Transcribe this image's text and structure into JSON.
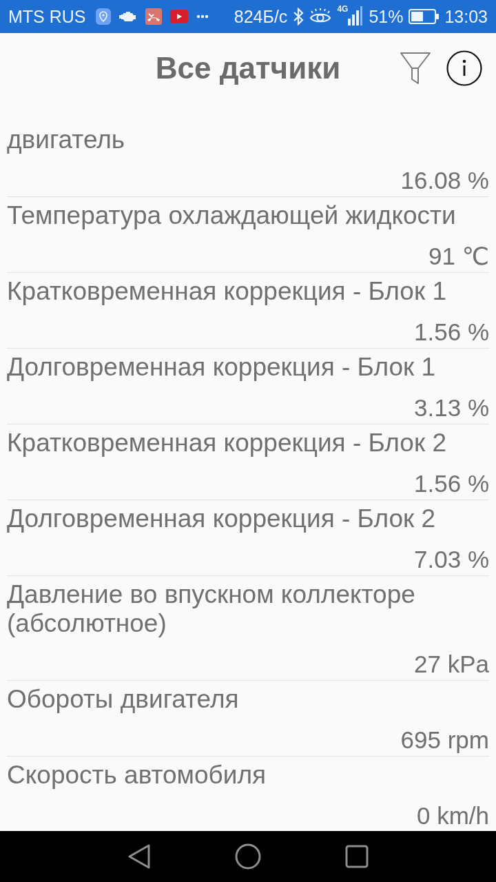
{
  "status_bar": {
    "carrier": "MTS RUS",
    "data_speed": "824Б/с",
    "network_type": "4G",
    "battery_percent": "51%",
    "time": "13:03"
  },
  "header": {
    "title": "Все датчики"
  },
  "sensors": [
    {
      "name": "двигатель",
      "value": "16.08 %"
    },
    {
      "name": "Температура охлаждающей жидкости",
      "value": "91 ℃"
    },
    {
      "name": "Кратковременная коррекция - Блок 1",
      "value": "1.56 %"
    },
    {
      "name": "Долговременная коррекция - Блок 1",
      "value": "3.13 %"
    },
    {
      "name": "Кратковременная коррекция - Блок 2",
      "value": "1.56 %"
    },
    {
      "name": "Долговременная коррекция - Блок 2",
      "value": "7.03 %"
    },
    {
      "name": "Давление во впускном коллекторе (абсолютное)",
      "value": "27 kPa"
    },
    {
      "name": "Обороты двигателя",
      "value": "695 rpm"
    },
    {
      "name": "Скорость автомобиля",
      "value": "0 km/h"
    }
  ]
}
